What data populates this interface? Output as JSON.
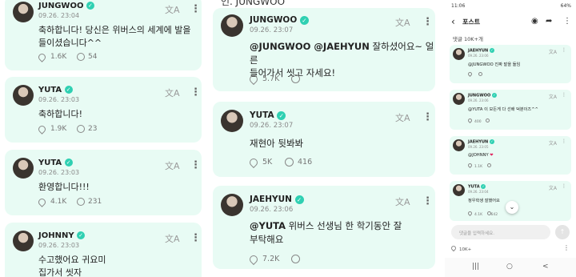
{
  "icons": {
    "translate": "文A",
    "more": "⋮",
    "like": "like-icon",
    "comment": "comment-icon",
    "verified": "✓"
  },
  "colors": {
    "card_bg": "#e8fbf4",
    "verified": "#2fd0b2",
    "heart": "#e0245e"
  },
  "panel1": {
    "posts": [
      {
        "name": "JUNGWOO",
        "date": "09.26. 23:04",
        "text_lines": [
          "축하합니다! 당신은 위버스의 세계에 발을",
          "들이셨습니다^^"
        ],
        "likes": "1.6K",
        "comments": "54"
      },
      {
        "name": "YUTA",
        "date": "09.26. 23:03",
        "text_lines": [
          "축하합니다!"
        ],
        "likes": "1.9K",
        "comments": "23"
      },
      {
        "name": "YUTA",
        "date": "09.26. 23:03",
        "text_lines": [
          "환영합니다!!!"
        ],
        "likes": "4.1K",
        "comments": "231"
      },
      {
        "name": "JOHNNY",
        "date": "09.26. 23:03",
        "text_lines": [
          "수고했어요 귀요미",
          "집가서 씻자"
        ]
      }
    ]
  },
  "panel2": {
    "top_fragment": "언. JUNGWOO",
    "posts": [
      {
        "name": "JUNGWOO",
        "date": "09.26. 23:07",
        "mention": "@JUNGWOO @JAEHYUN",
        "text_after": " 잘하셨어요~ 얼른",
        "text_line2": "들어가서 씻고 자세요!",
        "likes": "5.7K"
      },
      {
        "name": "YUTA",
        "date": "09.26. 23:07",
        "text": "재현아 뒷봐봐",
        "likes": "5K",
        "comments": "416"
      },
      {
        "name": "JAEHYUN",
        "date": "09.26. 23:06",
        "mention": "@YUTA",
        "text_after": " 위버스 선생님 한 학기동안 잘",
        "text_line2": "부탁해요",
        "likes": "7.2K"
      }
    ]
  },
  "panel3": {
    "status_time": "11:06",
    "status_right": "64%",
    "title": "포스트",
    "count": "댓글 10K+개",
    "comments": [
      {
        "name": "JAEHYUN",
        "date": "09.26. 23:06",
        "text": "@JUNGWOO 진짜 발을 들임",
        "likes": ""
      },
      {
        "name": "JUNGWOO",
        "date": "09.26. 23:06",
        "text": "@YUTA 이 모든게 다 선배 덕분이즈^^",
        "likes": "400"
      },
      {
        "name": "JAEHYUN",
        "date": "09.26. 23:05",
        "text": "@JOHNNY",
        "heart": "❤",
        "likes": "1.1K"
      },
      {
        "name": "YUTA",
        "date": "09.26. 23:04",
        "text": "정우학생 잘했어요",
        "likes": "4.1K",
        "comments": "642"
      }
    ],
    "input_placeholder": "댓글을 입력하세요.",
    "bottom_likes": "10K+",
    "nav": [
      "|||",
      "○",
      "<"
    ]
  }
}
